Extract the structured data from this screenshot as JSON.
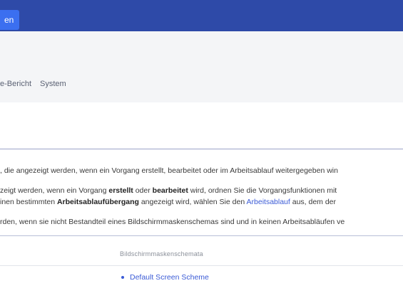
{
  "topbar": {
    "button_label": "en"
  },
  "admin_nav": {
    "items": [
      "e-Bericht",
      "System"
    ]
  },
  "intro": {
    "line1": ", die angezeigt werden, wenn ein Vorgang erstellt, bearbeitet oder im Arbeitsablauf weitergegeben win",
    "line2_pre": "zeigt werden, wenn ein Vorgang ",
    "line2_b1": "erstellt",
    "line2_mid": " oder ",
    "line2_b2": "bearbeitet",
    "line2_post": " wird, ordnen Sie die Vorgangsfunktionen mit",
    "line3_pre": "inen bestimmten ",
    "line3_b": "Arbeitsablaufübergang",
    "line3_mid": " angezeigt wird, wählen Sie den ",
    "line3_link": "Arbeitsablauf",
    "line3_post": " aus, dem der",
    "line4": "rden, wenn sie nicht Bestandteil eines Bildschirmmaskenschemas sind und in keinen Arbeitsabläufen ve"
  },
  "table": {
    "column_header": "Bildschirmmaskenschemata",
    "scheme_items": [
      "Default Screen Scheme"
    ]
  }
}
